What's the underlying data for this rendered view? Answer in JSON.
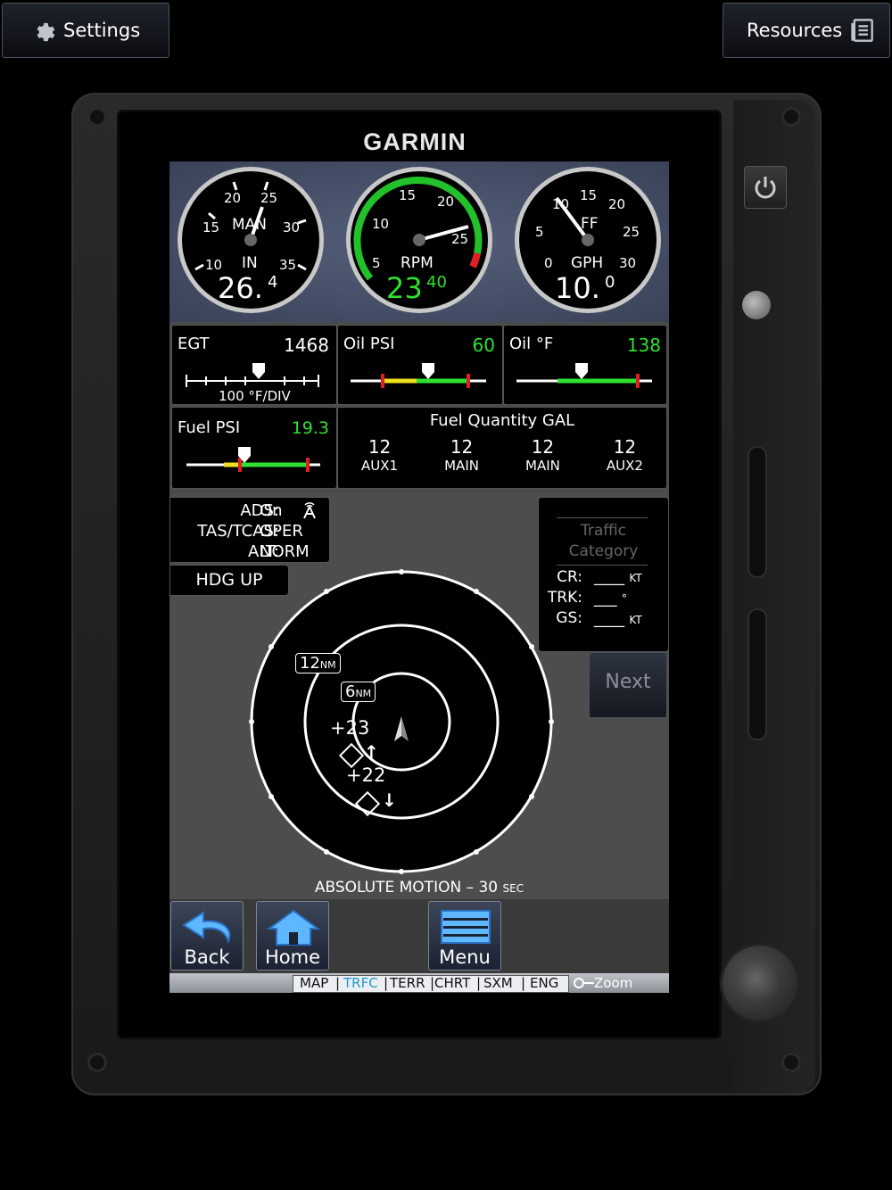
{
  "topbar": {
    "settings_label": "Settings",
    "resources_label": "Resources"
  },
  "device": {
    "brand": "GARMIN"
  },
  "gauges": {
    "man": {
      "unit": "IN",
      "title": "MAN",
      "value_main": "26.",
      "value_frac": "4",
      "ticks": [
        "10",
        "15",
        "20",
        "25",
        "30",
        "35"
      ]
    },
    "rpm": {
      "title": "RPM",
      "value_main": "23",
      "value_frac": "40",
      "ticks": [
        "5",
        "10",
        "15",
        "20",
        "25"
      ]
    },
    "ff": {
      "unit": "GPH",
      "title": "FF",
      "value_main": "10.",
      "value_frac": "0",
      "ticks": [
        "0",
        "5",
        "10",
        "15",
        "20",
        "25",
        "30"
      ]
    }
  },
  "engine": {
    "egt": {
      "label": "EGT",
      "value": "1468",
      "sub": "100 °F/DIV"
    },
    "oil_psi": {
      "label": "Oil PSI",
      "value": "60"
    },
    "oil_f": {
      "label": "Oil °F",
      "value": "138"
    },
    "fuel_psi": {
      "label": "Fuel PSI",
      "value": "19.3"
    },
    "fuel_qty": {
      "title": "Fuel Quantity GAL",
      "tanks": [
        {
          "value": "12",
          "name": "AUX1"
        },
        {
          "value": "12",
          "name": "MAIN"
        },
        {
          "value": "12",
          "name": "MAIN"
        },
        {
          "value": "12",
          "name": "AUX2"
        }
      ]
    }
  },
  "traffic": {
    "status": [
      {
        "k": "ADS:",
        "v": "On"
      },
      {
        "k": "TAS/TCAS:",
        "v": "OPER"
      },
      {
        "k": "ALT:",
        "v": "NORM"
      }
    ],
    "orientation": "HDG UP",
    "range_outer": "12",
    "range_inner": "6",
    "range_unit": "NM",
    "targets": [
      {
        "alt": "+23",
        "arrow": "↑"
      },
      {
        "alt": "+22",
        "arrow": "↓"
      }
    ],
    "info_title": "Traffic Category",
    "cr_label": "CR:",
    "cr_value": "____",
    "cr_unit": "KT",
    "trk_label": "TRK:",
    "trk_value": "___",
    "trk_unit": "°",
    "gs_label": "GS:",
    "gs_value": "____",
    "gs_unit": "KT",
    "next_label": "Next",
    "motion_label": "ABSOLUTE MOTION – 30",
    "motion_unit": "SEC"
  },
  "nav": {
    "back": "Back",
    "home": "Home",
    "menu": "Menu"
  },
  "tabs": {
    "items": [
      "MAP",
      "TRFC",
      "TERR",
      "CHRT",
      "SXM",
      "ENG"
    ],
    "active": "TRFC",
    "zoom": "Zoom"
  },
  "colors": {
    "green": "#2fe030",
    "yellow": "#f0e020",
    "red": "#e02020",
    "cyan": "#35c8ff",
    "white": "#ffffff"
  }
}
